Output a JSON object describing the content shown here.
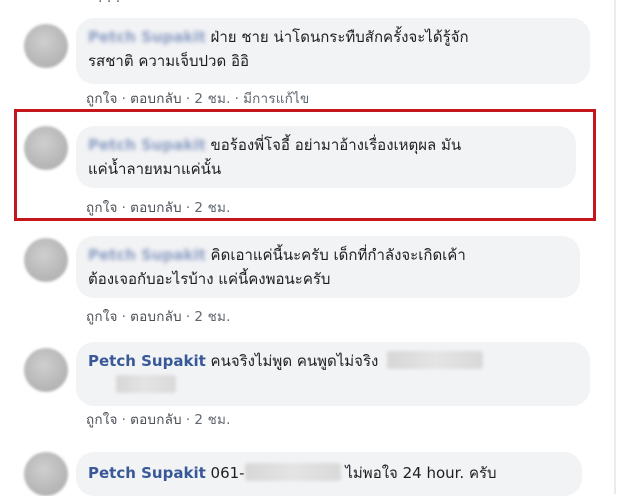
{
  "comments": [
    {
      "author": "Petch Supakit",
      "text": "ฝ่าย ชาย น่าโดนกระทืบสักครั้งจะได้รู้จักรสชาติ ความเจ็บปวด อิอิ",
      "line1": "ฝ่าย ชาย น่าโดนกระทืบสักครั้งจะได้รู้จัก",
      "line2": "รสชาติ ความเจ็บปวด อิอิ",
      "like": "ถูกใจ",
      "reply": "ตอบกลับ",
      "time": "2 ชม.",
      "edited": "มีการแก้ไข"
    },
    {
      "author": "Petch Supakit",
      "line1": "ขอร้องพี่โจอี้ อย่ามาอ้างเรื่องเหตุผล มัน",
      "line2": "แค่น้ำลายหมาแค่นั้น",
      "like": "ถูกใจ",
      "reply": "ตอบกลับ",
      "time": "2 ชม."
    },
    {
      "author": "Petch Supakit",
      "line1": "คิดเอาแค่นี้นะครับ เด็กที่กำลังจะเกิดเค้า",
      "line2": "ต้องเจอกับอะไรบ้าง แค่นี้คงพอนะครับ",
      "like": "ถูกใจ",
      "reply": "ตอบกลับ",
      "time": "2 ชม."
    },
    {
      "author": "Petch Supakit",
      "line1": "คนจริงไม่พูด คนพูดไม่จริง",
      "like": "ถูกใจ",
      "reply": "ตอบกลับ",
      "time": "2 ชม."
    },
    {
      "author": "Petch Supakit",
      "phone_prefix": "061-",
      "line1": "ไม่พอใจ 24 hour. ครับ"
    }
  ],
  "dot": "·"
}
